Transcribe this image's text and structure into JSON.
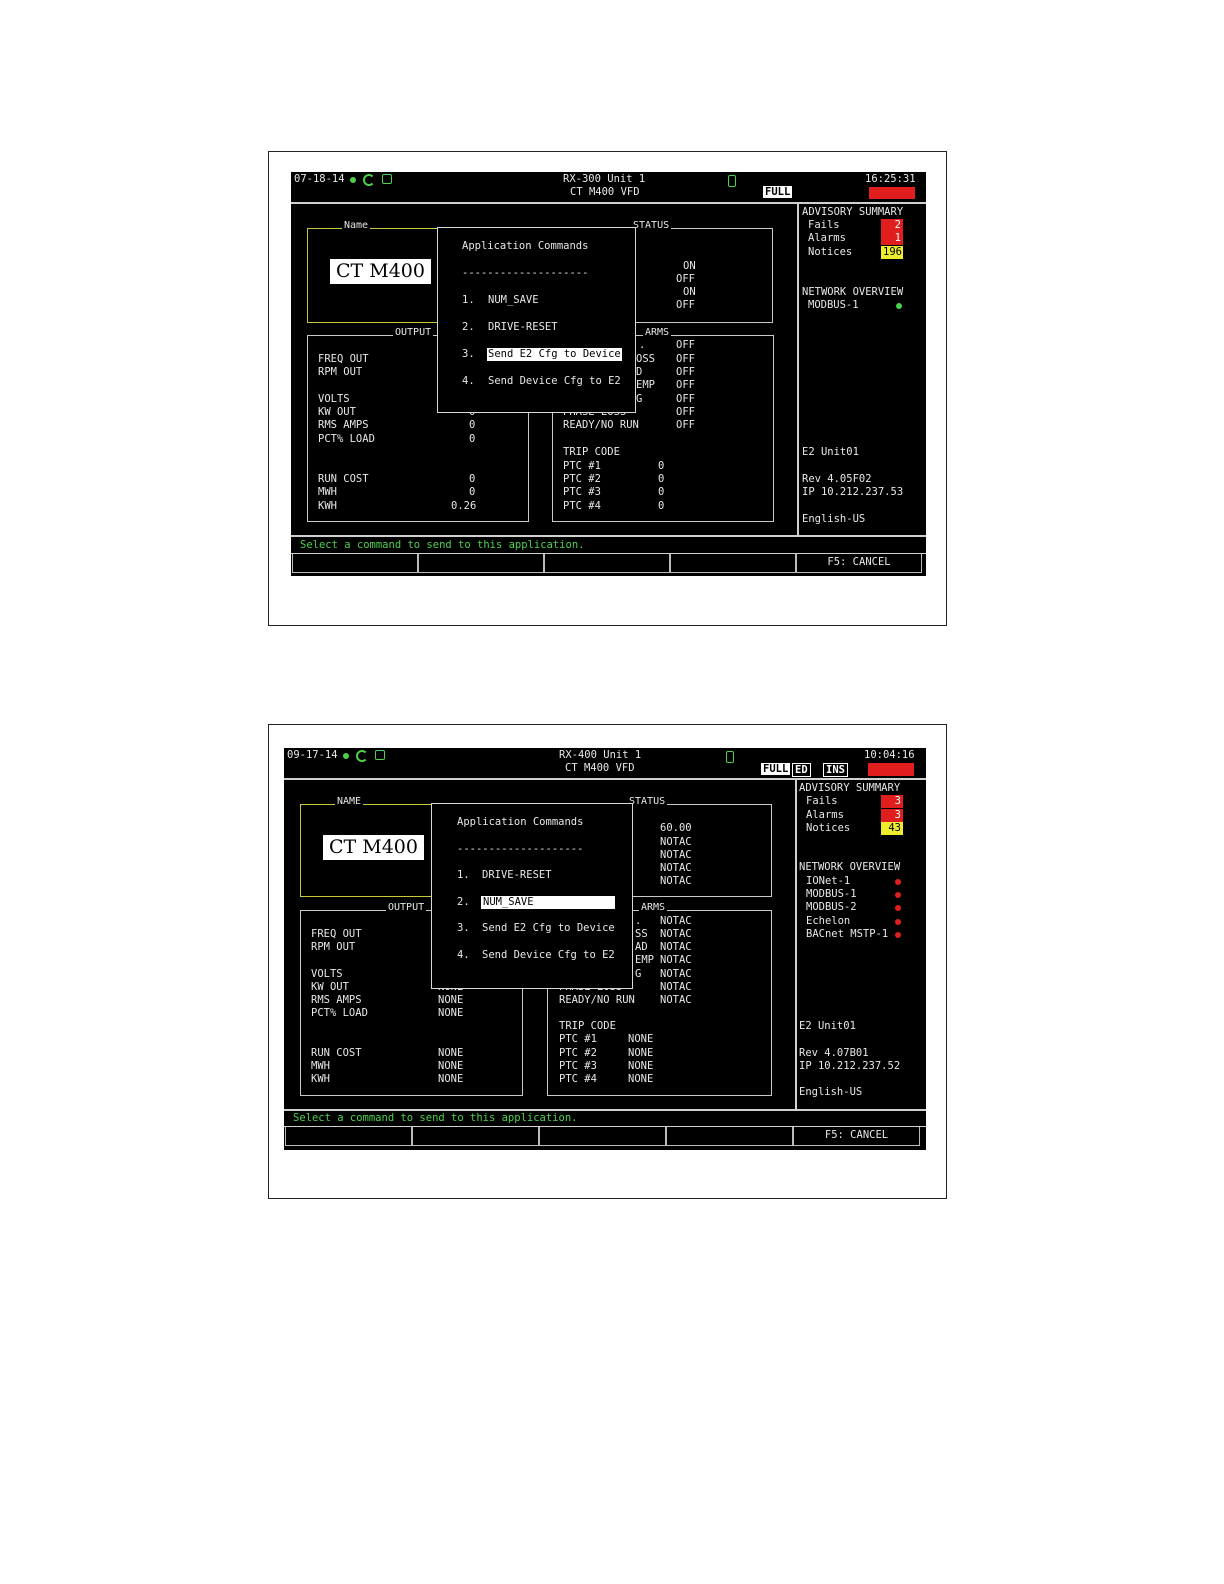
{
  "colors": {
    "screen_bg": "#000000",
    "status_green": "#4dd14d",
    "fail_red": "#e01e1e",
    "notice_yellow": "#eded2e"
  },
  "screen1": {
    "header": {
      "date": "07-18-14",
      "unit": "RX-300 Unit 1",
      "app": "CT M400 VFD",
      "time": "16:25:31",
      "mode": "FULL"
    },
    "name_label": "Name",
    "name_value": "CT M400",
    "status_label": "STATUS",
    "status_values": [
      "ON",
      "OFF",
      "ON",
      "OFF"
    ],
    "output_label": "OUTPUT",
    "output_rows_top": [
      "FREQ OUT",
      "RPM OUT"
    ],
    "output_rows_mid": [
      {
        "label": "VOLTS",
        "value": ""
      },
      {
        "label": "KW OUT",
        "value": "0"
      },
      {
        "label": "RMS AMPS",
        "value": "0"
      },
      {
        "label": "PCT% LOAD",
        "value": "0"
      }
    ],
    "output_rows_bottom": [
      {
        "label": "RUN COST",
        "value": "0"
      },
      {
        "label": "MWH",
        "value": "0"
      },
      {
        "label": "KWH",
        "value": "0.26"
      }
    ],
    "alarms_label": "ARMS",
    "alarm_frags": [
      ".",
      "OSS",
      "D",
      "EMP",
      "G",
      "PHASE LOSS"
    ],
    "alarm_values": [
      "OFF",
      "OFF",
      "OFF",
      "OFF",
      "OFF",
      "OFF",
      "OFF"
    ],
    "ready_label": "READY/NO RUN",
    "trip_label": "TRIP CODE",
    "ptc_rows": [
      {
        "label": "PTC #1",
        "value": "0"
      },
      {
        "label": "PTC #2",
        "value": "0"
      },
      {
        "label": "PTC #3",
        "value": "0"
      },
      {
        "label": "PTC #4",
        "value": "0"
      }
    ],
    "menu": {
      "title": "Application Commands",
      "divider": "--------------------",
      "items": [
        {
          "num": "1.",
          "label": "NUM_SAVE"
        },
        {
          "num": "2.",
          "label": "DRIVE-RESET"
        },
        {
          "num": "3.",
          "label": "Send E2 Cfg to Device"
        },
        {
          "num": "4.",
          "label": "Send Device Cfg to E2"
        }
      ],
      "selected_index": 2
    },
    "advisory": {
      "title": "ADVISORY SUMMARY",
      "fails_label": "Fails",
      "fails": "2",
      "alarms_label": "Alarms",
      "alarms": "1",
      "notices_label": "Notices",
      "notices": "196"
    },
    "network": {
      "title": "NETWORK OVERVIEW",
      "items": [
        "MODBUS-1"
      ]
    },
    "controller": {
      "name": "E2 Unit01",
      "rev": "Rev 4.05F02",
      "ip": "IP 10.212.237.53",
      "lang": "English-US"
    },
    "prompt": "Select a command to send to this application.",
    "fkeys": [
      "",
      "",
      "",
      "",
      "F5: CANCEL"
    ]
  },
  "screen2": {
    "header": {
      "date": "09-17-14",
      "unit": "RX-400 Unit 1",
      "app": "CT M400 VFD",
      "time": "10:04:16",
      "mode": "FULL",
      "ed": "ED",
      "ins": "INS"
    },
    "name_label": "NAME",
    "name_value": "CT M400",
    "status_label": "STATUS",
    "status_values": [
      "60.00",
      "NOTAC",
      "NOTAC",
      "NOTAC",
      "NOTAC"
    ],
    "output_label": "OUTPUT",
    "output_rows_top": [
      "FREQ OUT",
      "RPM OUT"
    ],
    "output_rows_mid": [
      {
        "label": "VOLTS",
        "value": ""
      },
      {
        "label": "KW OUT",
        "value": "NONE"
      },
      {
        "label": "RMS AMPS",
        "value": "NONE"
      },
      {
        "label": "PCT% LOAD",
        "value": "NONE"
      }
    ],
    "output_rows_bottom": [
      {
        "label": "RUN COST",
        "value": "NONE"
      },
      {
        "label": "MWH",
        "value": "NONE"
      },
      {
        "label": "KWH",
        "value": "NONE"
      }
    ],
    "alarms_label": "ARMS",
    "alarm_frags": [
      ".",
      "SS",
      "AD",
      "EMP",
      "G",
      "PHASE LOSS"
    ],
    "alarm_values": [
      "NOTAC",
      "NOTAC",
      "NOTAC",
      "NOTAC",
      "NOTAC",
      "NOTAC",
      "NOTAC"
    ],
    "ready_label": "READY/NO RUN",
    "trip_label": "TRIP CODE",
    "ptc_rows": [
      {
        "label": "PTC #1",
        "value": "NONE"
      },
      {
        "label": "PTC #2",
        "value": "NONE"
      },
      {
        "label": "PTC #3",
        "value": "NONE"
      },
      {
        "label": "PTC #4",
        "value": "NONE"
      }
    ],
    "menu": {
      "title": "Application Commands",
      "divider": "--------------------",
      "items": [
        {
          "num": "1.",
          "label": "DRIVE-RESET"
        },
        {
          "num": "2.",
          "label": "NUM_SAVE"
        },
        {
          "num": "3.",
          "label": "Send E2 Cfg to Device"
        },
        {
          "num": "4.",
          "label": "Send Device Cfg to E2"
        }
      ],
      "selected_index": 1
    },
    "advisory": {
      "title": "ADVISORY SUMMARY",
      "fails_label": "Fails",
      "fails": "3",
      "alarms_label": "Alarms",
      "alarms": "3",
      "notices_label": "Notices",
      "notices": "43"
    },
    "network": {
      "title": "NETWORK OVERVIEW",
      "items": [
        "IONet-1",
        "MODBUS-1",
        "MODBUS-2",
        "Echelon",
        "BACnet MSTP-1"
      ]
    },
    "controller": {
      "name": "E2 Unit01",
      "rev": "Rev 4.07B01",
      "ip": "IP 10.212.237.52",
      "lang": "English-US"
    },
    "prompt": "Select a command to send to this application.",
    "fkeys": [
      "",
      "",
      "",
      "",
      "F5: CANCEL"
    ]
  }
}
